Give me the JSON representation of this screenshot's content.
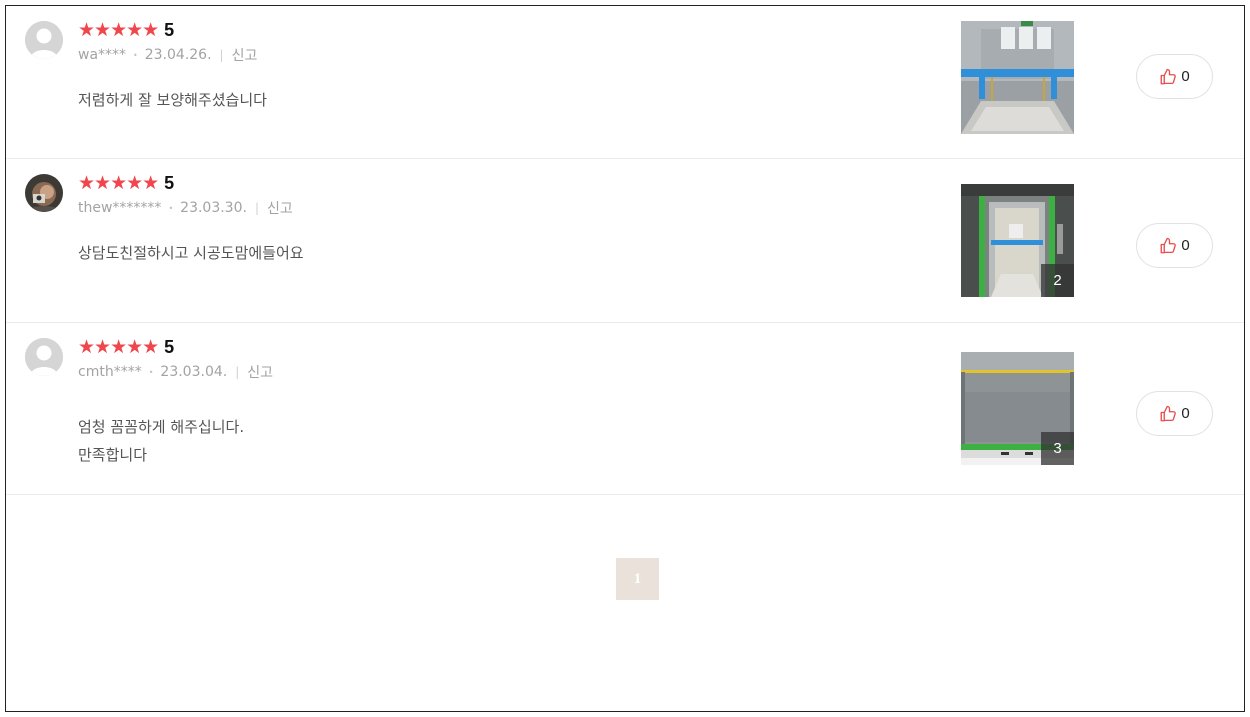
{
  "reviews": [
    {
      "stars": "★★★★★",
      "rating": "5",
      "rating_fraction": 1.0,
      "author": "wa****",
      "date": "23.04.26.",
      "report_label": "신고",
      "content_lines": [
        "저렴하게 잘 보양해주셨습니다"
      ],
      "photo_count": "",
      "like_count": "0",
      "avatar": "default-avatar"
    },
    {
      "stars": "★★★★★",
      "rating": "5",
      "rating_fraction": 1.0,
      "author": "thew*******",
      "date": "23.03.30.",
      "report_label": "신고",
      "content_lines": [
        "상담도친절하시고 시공도맘에들어요"
      ],
      "photo_count": "2",
      "like_count": "0",
      "avatar": "user-photo-avatar"
    },
    {
      "stars": "★★★★★",
      "rating": "5",
      "rating_fraction": 1.0,
      "author": "cmth****",
      "date": "23.03.04.",
      "report_label": "신고",
      "content_lines": [
        "엄청 꼼꼼하게 해주십니다.",
        "만족합니다"
      ],
      "photo_count": "3",
      "like_count": "0",
      "avatar": "default-avatar"
    }
  ],
  "pagination": {
    "current_page": "1"
  },
  "colors": {
    "star": "#f0474f",
    "like_icon": "#e84c4c",
    "page_active_bg": "#eae2da"
  },
  "icons": {
    "like": "thumbs-up-icon",
    "star": "star-icon"
  }
}
